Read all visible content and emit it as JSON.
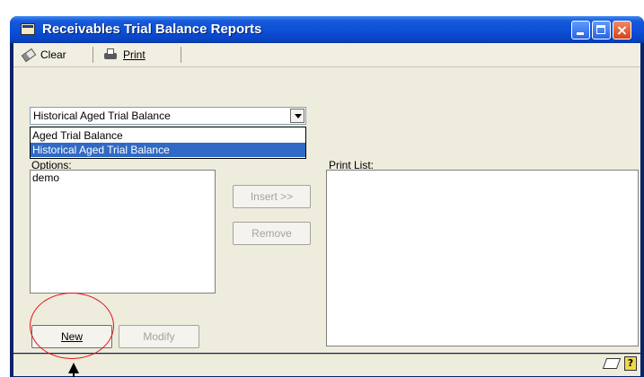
{
  "window": {
    "title": "Receivables Trial Balance Reports",
    "icon": "report-window-icon"
  },
  "toolbar": {
    "clear_label": "Clear",
    "print_label": "Print"
  },
  "report_select": {
    "selected": "Historical Aged Trial Balance",
    "options": [
      "Aged Trial Balance",
      "Historical Aged Trial Balance"
    ],
    "highlighted_index": 1
  },
  "options_panel": {
    "label": "Options:",
    "items": [
      "demo"
    ]
  },
  "print_list": {
    "label": "Print List:",
    "items": []
  },
  "buttons": {
    "insert": "Insert >>",
    "remove": "Remove",
    "new": "New",
    "modify": "Modify"
  },
  "colors": {
    "title_bar": "#0b4fd6",
    "selection": "#316ac5",
    "annotation_ring": "#e4141c",
    "panel_bg": "#eeecdc"
  }
}
